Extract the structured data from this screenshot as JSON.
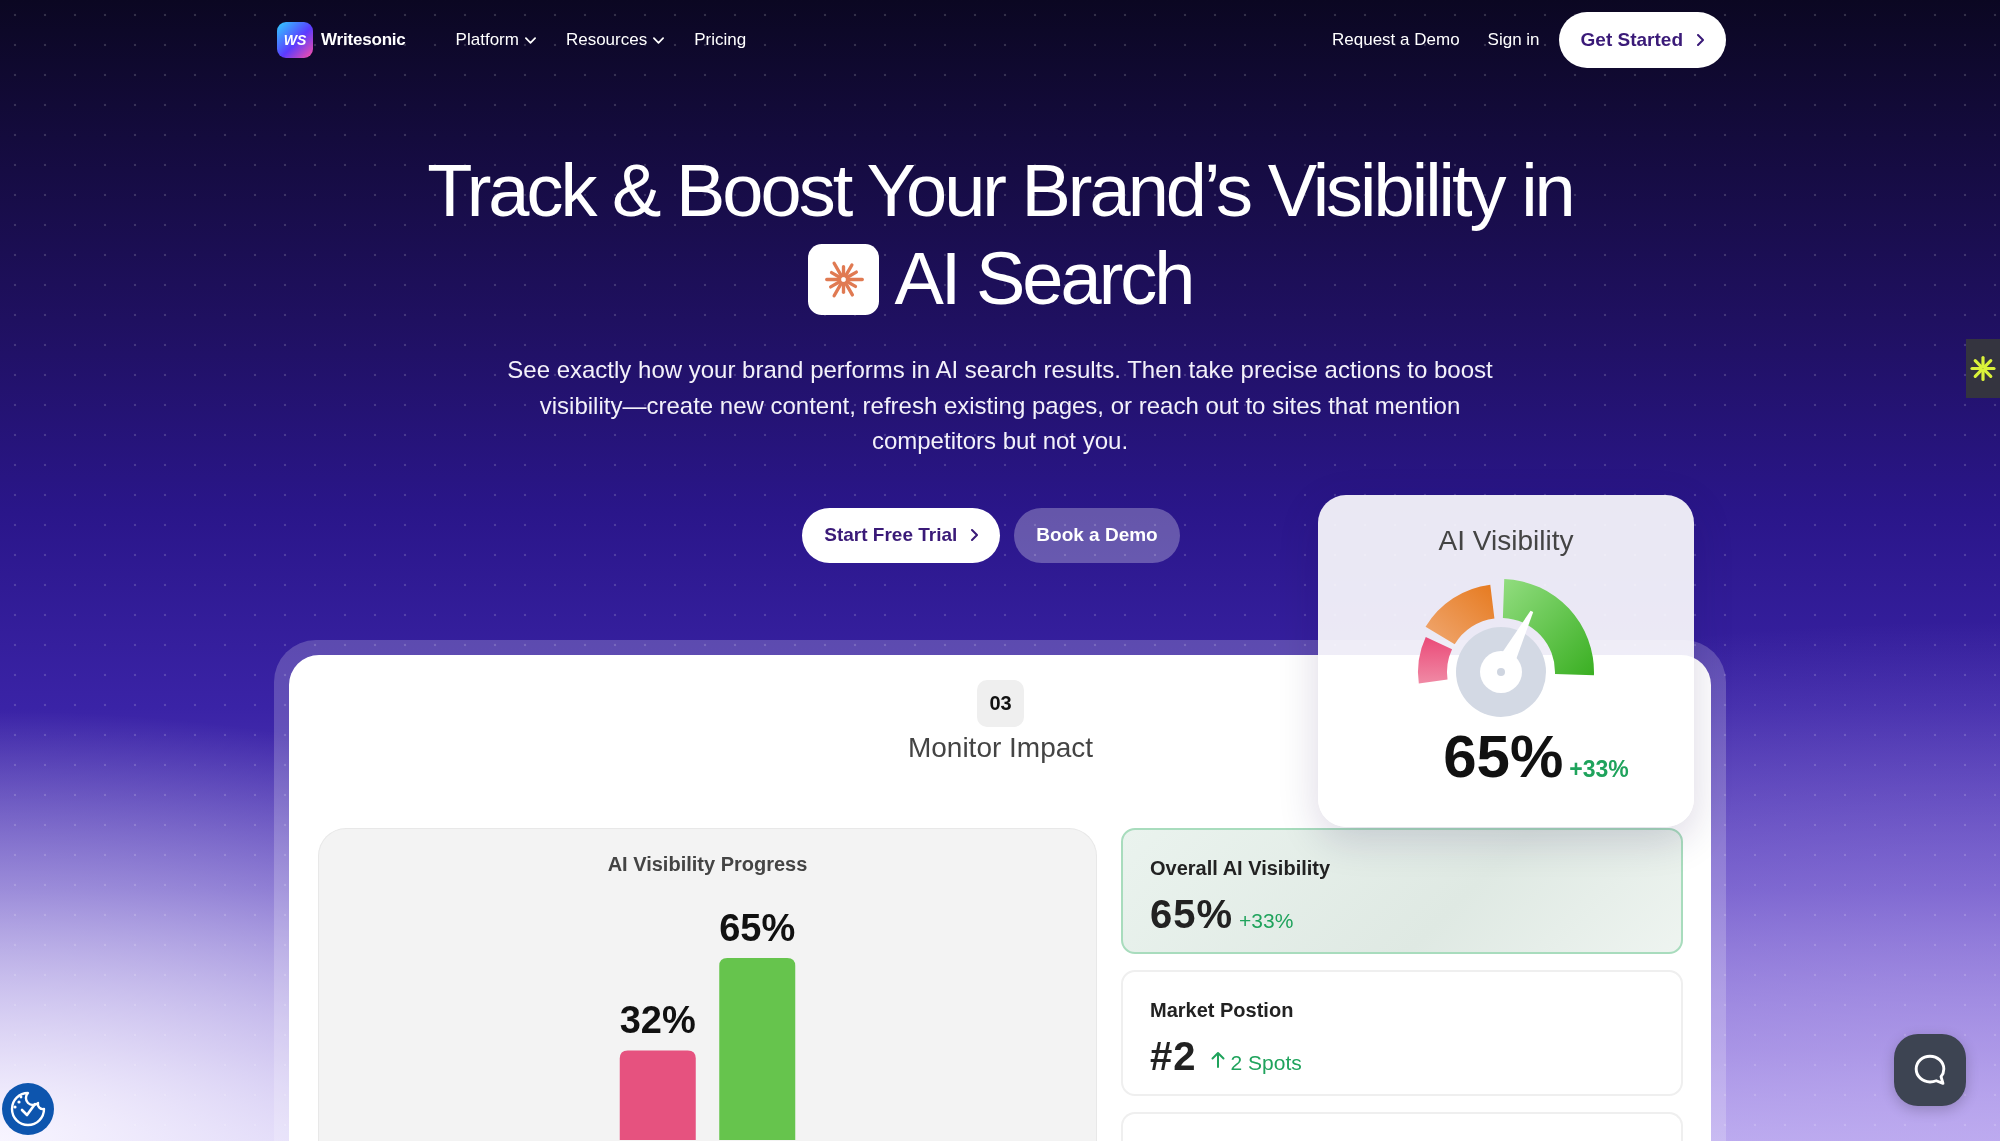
{
  "nav": {
    "logo": {
      "mark": "WS",
      "name": "Writesonic"
    },
    "links": [
      {
        "label": "Platform",
        "has_menu": true
      },
      {
        "label": "Resources",
        "has_menu": true
      },
      {
        "label": "Pricing",
        "has_menu": false
      }
    ],
    "actions": [
      {
        "label": "Request a Demo",
        "kind": "link"
      },
      {
        "label": "Sign in",
        "kind": "link"
      },
      {
        "label": "Get Started",
        "kind": "button"
      }
    ]
  },
  "hero": {
    "title": "Track & Boost Your Brand’s Visibility in",
    "title_end": "AI Search",
    "subtitle": "See exactly how your brand performs in AI search results. Then take precise actions to boost visibility—create new content, refresh existing pages, or reach out to sites that mention competitors but not you.",
    "buttons": [
      {
        "label": "Start Free Trial",
        "kind": "primary"
      },
      {
        "label": "Book a Demo",
        "kind": "secondary"
      }
    ]
  },
  "showcase": {
    "step": "03",
    "heading": "Monitor Impact",
    "progress": {
      "chart_data": {
        "type": "bar",
        "title": "AI Visibility Progress",
        "values": [
          32,
          65
        ],
        "value_labels": [
          "32%",
          "65%"
        ],
        "colors": [
          "#e6527f",
          "#66c44d"
        ]
      }
    },
    "metrics": [
      {
        "label": "Overall AI Visibility",
        "value": "65%",
        "change": "+33%",
        "arrow": false,
        "highlighted": true
      },
      {
        "label": "Market Postion",
        "value": "#2",
        "change": "2 Spots",
        "arrow": true,
        "highlighted": false
      },
      {
        "highlighted": false
      }
    ]
  },
  "visibility_card": {
    "title": "AI Visibility",
    "gauge": {
      "level": 0.65
    },
    "value": "65%",
    "change": "+33%"
  }
}
